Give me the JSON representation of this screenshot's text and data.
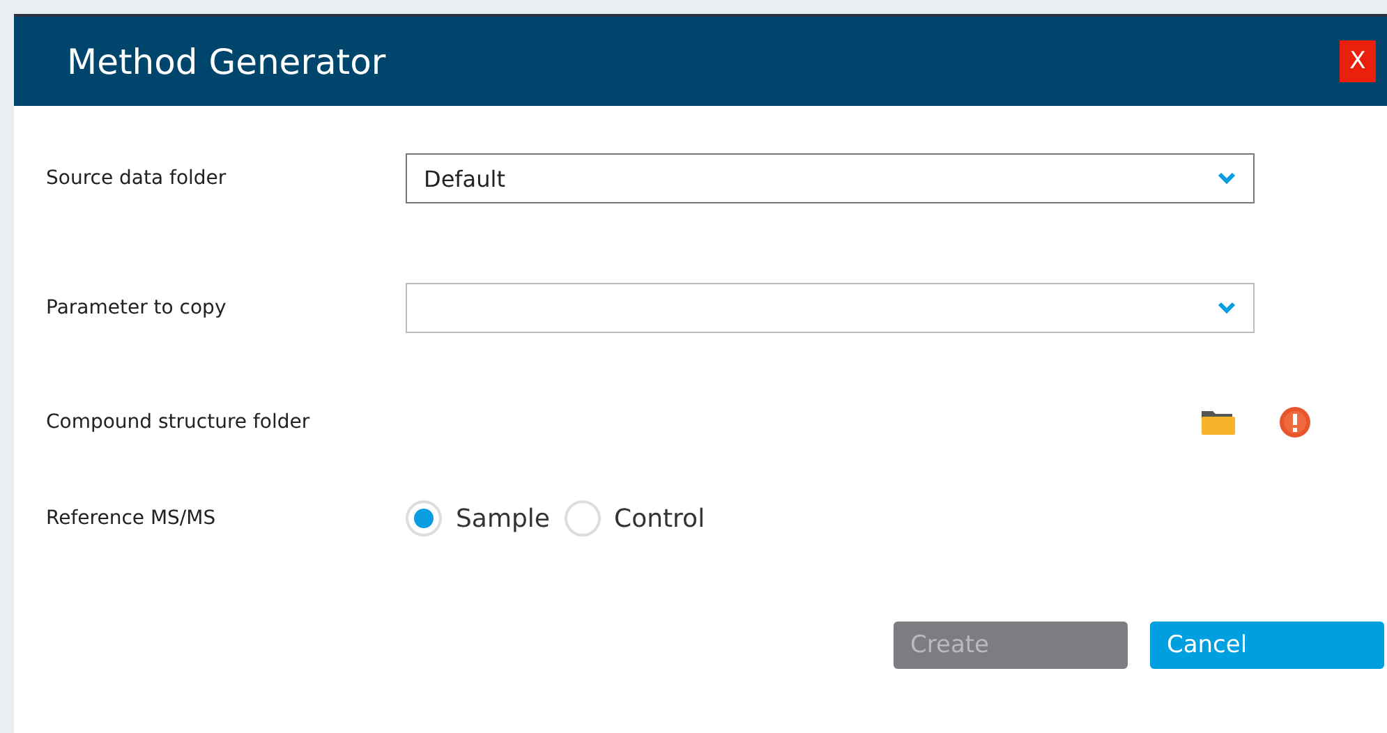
{
  "window": {
    "title": "Method Generator",
    "close": "X"
  },
  "fields": [
    {
      "kind": "dropdown",
      "label": "Source data folder",
      "value": "Default"
    },
    {
      "kind": "dropdown",
      "label": "Parameter to copy"
    },
    {
      "kind": "folder",
      "label": "Compound structure folder",
      "error": true
    },
    {
      "kind": "radio",
      "label": "Reference MS/MS",
      "options": [
        {
          "label": "Sample",
          "selected": true
        },
        {
          "label": "Control",
          "selected": false
        }
      ]
    }
  ],
  "buttons": [
    {
      "label": "Create",
      "disabled": true
    },
    {
      "label": "Cancel",
      "disabled": false
    }
  ]
}
